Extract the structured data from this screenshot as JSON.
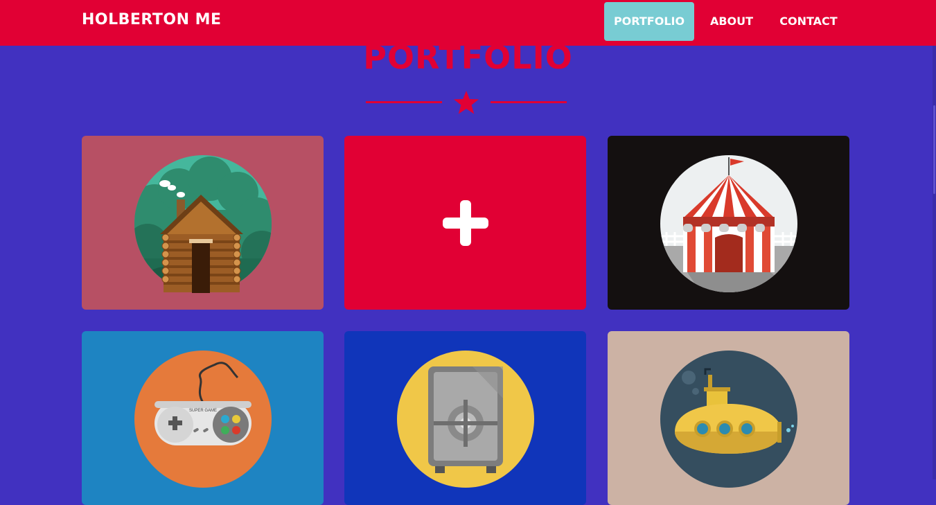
{
  "navbar": {
    "brand": "HOLBERTON ME",
    "links": [
      {
        "label": "PORTFOLIO",
        "active": true
      },
      {
        "label": "ABOUT",
        "active": false
      },
      {
        "label": "CONTACT",
        "active": false
      }
    ]
  },
  "portfolio": {
    "title": "PORTFOLIO",
    "items": [
      {
        "subject": "cabin",
        "background": "#b75064"
      },
      {
        "subject": "plus",
        "background": "#e10034"
      },
      {
        "subject": "circus-tent",
        "background": "#141010"
      },
      {
        "subject": "game-controller",
        "background": "#1e84c2",
        "controller_text": "SUPER GAME"
      },
      {
        "subject": "safe",
        "background": "#1035ba"
      },
      {
        "subject": "submarine",
        "background": "#ccb2a4"
      }
    ]
  },
  "colors": {
    "page_background": "#4131c0",
    "navbar": "#e10034",
    "active_link": "#78ccd3",
    "accent": "#e10034"
  }
}
